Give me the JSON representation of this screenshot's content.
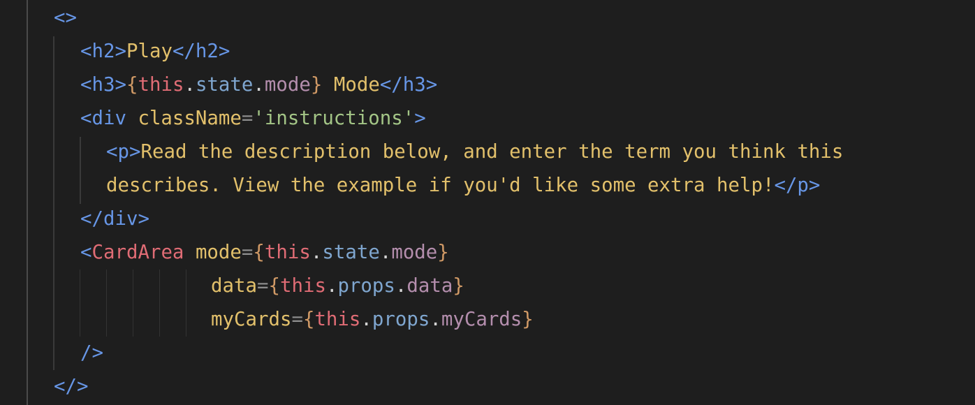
{
  "code": {
    "lines": [
      [
        {
          "t": "<>",
          "c": "tag"
        }
      ],
      [
        {
          "t": "<h2>",
          "c": "tag"
        },
        {
          "t": "Play",
          "c": "text"
        },
        {
          "t": "</h2>",
          "c": "tag"
        }
      ],
      [
        {
          "t": "<h3>",
          "c": "tag"
        },
        {
          "t": "{",
          "c": "brace"
        },
        {
          "t": "this",
          "c": "kw"
        },
        {
          "t": ".",
          "c": "punct"
        },
        {
          "t": "state",
          "c": "state"
        },
        {
          "t": ".",
          "c": "punct"
        },
        {
          "t": "mode",
          "c": "prop"
        },
        {
          "t": "}",
          "c": "brace"
        },
        {
          "t": " Mode",
          "c": "text"
        },
        {
          "t": "</h3>",
          "c": "tag"
        }
      ],
      [
        {
          "t": "<div ",
          "c": "tag"
        },
        {
          "t": "className",
          "c": "attr"
        },
        {
          "t": "=",
          "c": "eq"
        },
        {
          "t": "'instructions'",
          "c": "str"
        },
        {
          "t": ">",
          "c": "tag"
        }
      ],
      [
        {
          "t": "<p>",
          "c": "tag"
        },
        {
          "t": "Read the description below, and enter the term you think this",
          "c": "text"
        }
      ],
      [
        {
          "t": "describes. View the example if you'd like some extra help!",
          "c": "text"
        },
        {
          "t": "</p>",
          "c": "tag"
        }
      ],
      [
        {
          "t": "</div>",
          "c": "tag"
        }
      ],
      [
        {
          "t": "<",
          "c": "tag"
        },
        {
          "t": "CardArea",
          "c": "comp"
        },
        {
          "t": " ",
          "c": "punct"
        },
        {
          "t": "mode",
          "c": "attr"
        },
        {
          "t": "=",
          "c": "eq"
        },
        {
          "t": "{",
          "c": "brace"
        },
        {
          "t": "this",
          "c": "kw"
        },
        {
          "t": ".",
          "c": "punct"
        },
        {
          "t": "state",
          "c": "state"
        },
        {
          "t": ".",
          "c": "punct"
        },
        {
          "t": "mode",
          "c": "prop"
        },
        {
          "t": "}",
          "c": "brace"
        }
      ],
      [
        {
          "t": "data",
          "c": "attr"
        },
        {
          "t": "=",
          "c": "eq"
        },
        {
          "t": "{",
          "c": "brace"
        },
        {
          "t": "this",
          "c": "kw"
        },
        {
          "t": ".",
          "c": "punct"
        },
        {
          "t": "props",
          "c": "state"
        },
        {
          "t": ".",
          "c": "punct"
        },
        {
          "t": "data",
          "c": "prop"
        },
        {
          "t": "}",
          "c": "brace"
        }
      ],
      [
        {
          "t": "myCards",
          "c": "attr"
        },
        {
          "t": "=",
          "c": "eq"
        },
        {
          "t": "{",
          "c": "brace"
        },
        {
          "t": "this",
          "c": "kw"
        },
        {
          "t": ".",
          "c": "punct"
        },
        {
          "t": "props",
          "c": "state"
        },
        {
          "t": ".",
          "c": "punct"
        },
        {
          "t": "myCards",
          "c": "prop"
        },
        {
          "t": "}",
          "c": "brace"
        }
      ],
      [
        {
          "t": "/>",
          "c": "tag"
        }
      ],
      [
        {
          "t": "</>",
          "c": "tag"
        }
      ]
    ]
  },
  "colors": {
    "background": "#1e1e1e",
    "tag": "#6796e6",
    "component": "#e06c75",
    "text": "#e2c06b",
    "string": "#a3c586",
    "brace": "#d19a66",
    "keyword": "#e06c75",
    "property": "#b48ead",
    "object": "#7fa6cf"
  }
}
